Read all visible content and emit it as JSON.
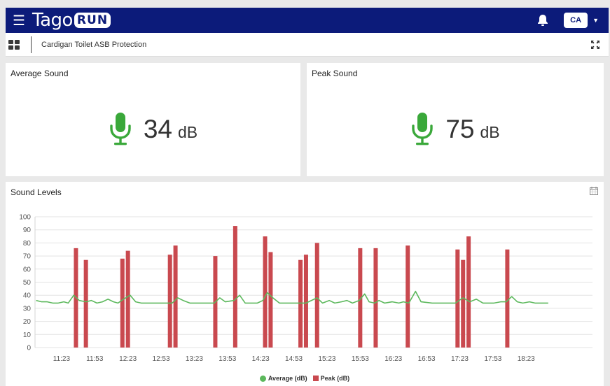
{
  "header": {
    "logo_text": "Tago",
    "logo_badge": "RUN",
    "user_initials": "CA",
    "icons": [
      "menu-icon",
      "bell-icon",
      "chevron-down-icon"
    ],
    "colors": {
      "bar": "#0c1b7a"
    }
  },
  "subheader": {
    "dashboard_title": "Cardigan Toilet ASB Protection",
    "icons": [
      "dashboard-grid-icon",
      "fullscreen-icon"
    ]
  },
  "average_card": {
    "title": "Average Sound",
    "value": "34",
    "unit": "dB",
    "icon": "microphone-icon",
    "icon_color": "#3aa83a"
  },
  "peak_card": {
    "title": "Peak Sound",
    "value": "75",
    "unit": "dB",
    "icon": "microphone-icon",
    "icon_color": "#3aa83a"
  },
  "chart_card": {
    "title": "Sound Levels",
    "icon": "calendar-icon"
  },
  "chart_data": {
    "type": "bar",
    "title": "Sound Levels",
    "xlabel": "",
    "ylabel": "",
    "ylim": [
      0,
      100
    ],
    "yticks": [
      0,
      10,
      20,
      30,
      40,
      50,
      60,
      70,
      80,
      90,
      100
    ],
    "x_range": [
      "10:59",
      "19:23"
    ],
    "xticks": [
      "11:23",
      "11:53",
      "12:23",
      "12:53",
      "13:23",
      "13:53",
      "14:23",
      "14:53",
      "15:23",
      "15:53",
      "16:23",
      "16:53",
      "17:23",
      "17:53",
      "18:23"
    ],
    "grid": true,
    "legend_position": "bottom",
    "series": [
      {
        "name": "Average (dB)",
        "type": "line",
        "color": "#5cb85c",
        "points": [
          [
            "11:00",
            36
          ],
          [
            "11:05",
            35
          ],
          [
            "11:10",
            35
          ],
          [
            "11:15",
            34
          ],
          [
            "11:20",
            34
          ],
          [
            "11:25",
            35
          ],
          [
            "11:29",
            34
          ],
          [
            "11:34",
            40
          ],
          [
            "11:39",
            36
          ],
          [
            "11:45",
            35
          ],
          [
            "11:50",
            36
          ],
          [
            "11:55",
            34
          ],
          [
            "12:00",
            35
          ],
          [
            "12:05",
            37
          ],
          [
            "12:10",
            35
          ],
          [
            "12:14",
            34
          ],
          [
            "12:19",
            37
          ],
          [
            "12:25",
            40
          ],
          [
            "12:30",
            35
          ],
          [
            "12:35",
            34
          ],
          [
            "12:45",
            34
          ],
          [
            "12:55",
            34
          ],
          [
            "13:03",
            34
          ],
          [
            "13:08",
            38
          ],
          [
            "13:13",
            36
          ],
          [
            "13:19",
            34
          ],
          [
            "13:30",
            34
          ],
          [
            "13:41",
            34
          ],
          [
            "13:46",
            38
          ],
          [
            "13:51",
            35
          ],
          [
            "13:59",
            36
          ],
          [
            "14:04",
            40
          ],
          [
            "14:09",
            34
          ],
          [
            "14:20",
            34
          ],
          [
            "14:25",
            36
          ],
          [
            "14:29",
            42
          ],
          [
            "14:34",
            38
          ],
          [
            "14:40",
            34
          ],
          [
            "14:51",
            34
          ],
          [
            "15:04",
            34
          ],
          [
            "15:14",
            38
          ],
          [
            "15:19",
            34
          ],
          [
            "15:25",
            36
          ],
          [
            "15:30",
            34
          ],
          [
            "15:36",
            35
          ],
          [
            "15:41",
            36
          ],
          [
            "15:46",
            34
          ],
          [
            "15:52",
            36
          ],
          [
            "15:57",
            41
          ],
          [
            "16:01",
            35
          ],
          [
            "16:06",
            34
          ],
          [
            "16:10",
            36
          ],
          [
            "16:15",
            34
          ],
          [
            "16:22",
            35
          ],
          [
            "16:28",
            34
          ],
          [
            "16:32",
            35
          ],
          [
            "16:37",
            34
          ],
          [
            "16:43",
            43
          ],
          [
            "16:48",
            35
          ],
          [
            "16:58",
            34
          ],
          [
            "17:08",
            34
          ],
          [
            "17:19",
            34
          ],
          [
            "17:26",
            38
          ],
          [
            "17:32",
            35
          ],
          [
            "17:38",
            37
          ],
          [
            "17:44",
            34
          ],
          [
            "17:54",
            34
          ],
          [
            "18:00",
            35
          ],
          [
            "18:05",
            35
          ],
          [
            "18:10",
            39
          ],
          [
            "18:15",
            35
          ],
          [
            "18:20",
            34
          ],
          [
            "18:26",
            35
          ],
          [
            "18:31",
            34
          ],
          [
            "18:43",
            34
          ]
        ]
      },
      {
        "name": "Peak (dB)",
        "type": "bar",
        "color": "#c9494f",
        "points": [
          [
            "11:36",
            76
          ],
          [
            "11:45",
            67
          ],
          [
            "12:18",
            68
          ],
          [
            "12:23",
            74
          ],
          [
            "13:01",
            71
          ],
          [
            "13:06",
            78
          ],
          [
            "13:42",
            70
          ],
          [
            "14:00",
            93
          ],
          [
            "14:27",
            85
          ],
          [
            "14:32",
            73
          ],
          [
            "14:59",
            67
          ],
          [
            "15:04",
            71
          ],
          [
            "15:14",
            80
          ],
          [
            "15:53",
            76
          ],
          [
            "16:07",
            76
          ],
          [
            "16:36",
            78
          ],
          [
            "17:21",
            75
          ],
          [
            "17:26",
            67
          ],
          [
            "17:31",
            85
          ],
          [
            "18:06",
            75
          ]
        ]
      }
    ]
  }
}
